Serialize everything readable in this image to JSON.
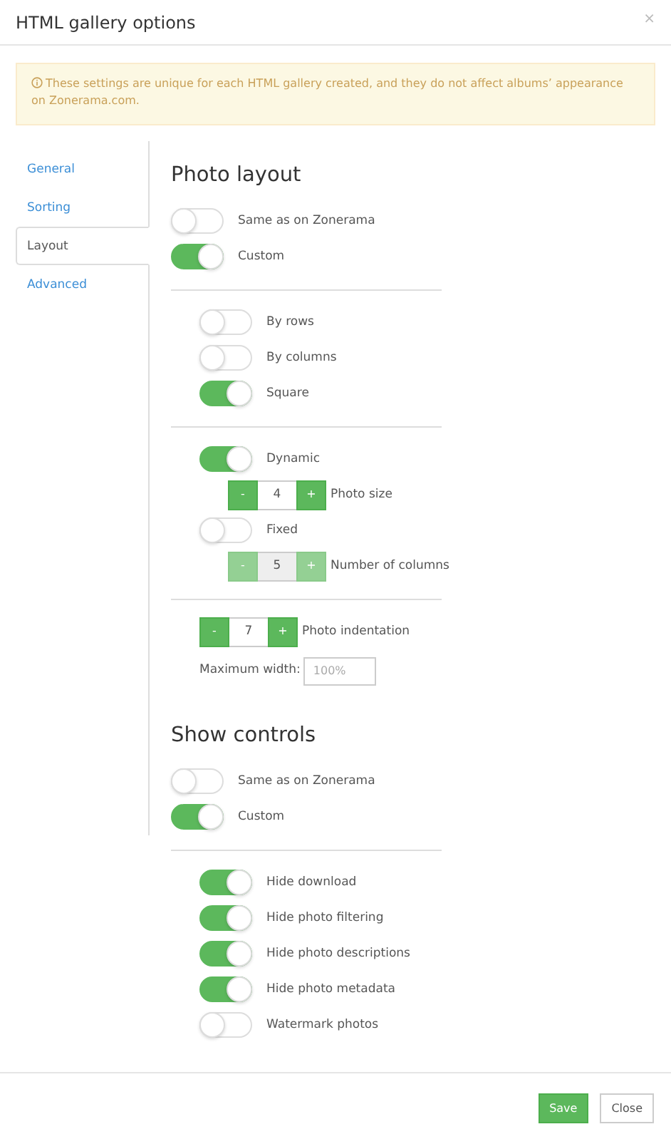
{
  "dialog": {
    "title": "HTML gallery options",
    "close": "×"
  },
  "alert": {
    "text": "These settings are unique for each HTML gallery created, and they do not affect albums’ appearance on Zonerama.com."
  },
  "nav": [
    {
      "label": "General",
      "selected": false
    },
    {
      "label": "Sorting",
      "selected": false
    },
    {
      "label": "Layout",
      "selected": true
    },
    {
      "label": "Advanced",
      "selected": false
    }
  ],
  "photo_layout": {
    "heading": "Photo layout",
    "source": [
      {
        "label": "Same as on Zonerama",
        "on": false
      },
      {
        "label": "Custom",
        "on": true
      }
    ],
    "groups": [
      [
        {
          "kind": "toggle",
          "label": "By rows",
          "on": false
        },
        {
          "kind": "toggle",
          "label": "By columns",
          "on": false
        },
        {
          "kind": "toggle",
          "label": "Square",
          "on": true
        }
      ],
      [
        {
          "kind": "toggle",
          "label": "Dynamic",
          "on": true,
          "children": [
            {
              "kind": "stepper",
              "minus": "-",
              "value": "4",
              "plus": "+",
              "label": "Photo size",
              "disabled": false
            }
          ]
        },
        {
          "kind": "toggle",
          "label": "Fixed",
          "on": false,
          "children": [
            {
              "kind": "stepper",
              "minus": "-",
              "value": "5",
              "plus": "+",
              "label": "Number of columns",
              "disabled": true
            }
          ]
        }
      ],
      [
        {
          "kind": "stepper",
          "minus": "-",
          "value": "7",
          "plus": "+",
          "label": "Photo indentation",
          "disabled": false
        },
        {
          "kind": "field",
          "label": "Maximum width:",
          "placeholder": "100%"
        }
      ]
    ]
  },
  "show_controls": {
    "heading": "Show controls",
    "source": [
      {
        "label": "Same as on Zonerama",
        "on": false
      },
      {
        "label": "Custom",
        "on": true
      }
    ],
    "options": [
      {
        "label": "Hide download",
        "on": true
      },
      {
        "label": "Hide photo filtering",
        "on": true
      },
      {
        "label": "Hide photo descriptions",
        "on": true
      },
      {
        "label": "Hide photo metadata",
        "on": true
      },
      {
        "label": "Watermark photos",
        "on": false
      }
    ]
  },
  "footer": [
    {
      "label": "Save",
      "kind": "primary"
    },
    {
      "label": "Close",
      "kind": "secondary"
    }
  ]
}
